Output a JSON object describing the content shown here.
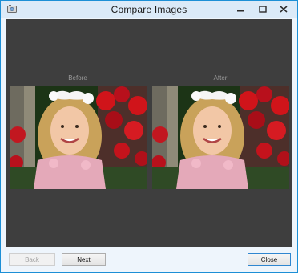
{
  "window": {
    "title": "Compare Images",
    "controls": [
      "minimize-icon",
      "maximize-icon",
      "close-icon"
    ]
  },
  "comparison": {
    "before_label": "Before",
    "after_label": "After"
  },
  "footer": {
    "back_label": "Back",
    "next_label": "Next",
    "close_label": "Close"
  },
  "colors": {
    "titlebar": "#dbeaf8",
    "content_bg": "#3e3e3e",
    "window_border": "#1c8fd6"
  }
}
